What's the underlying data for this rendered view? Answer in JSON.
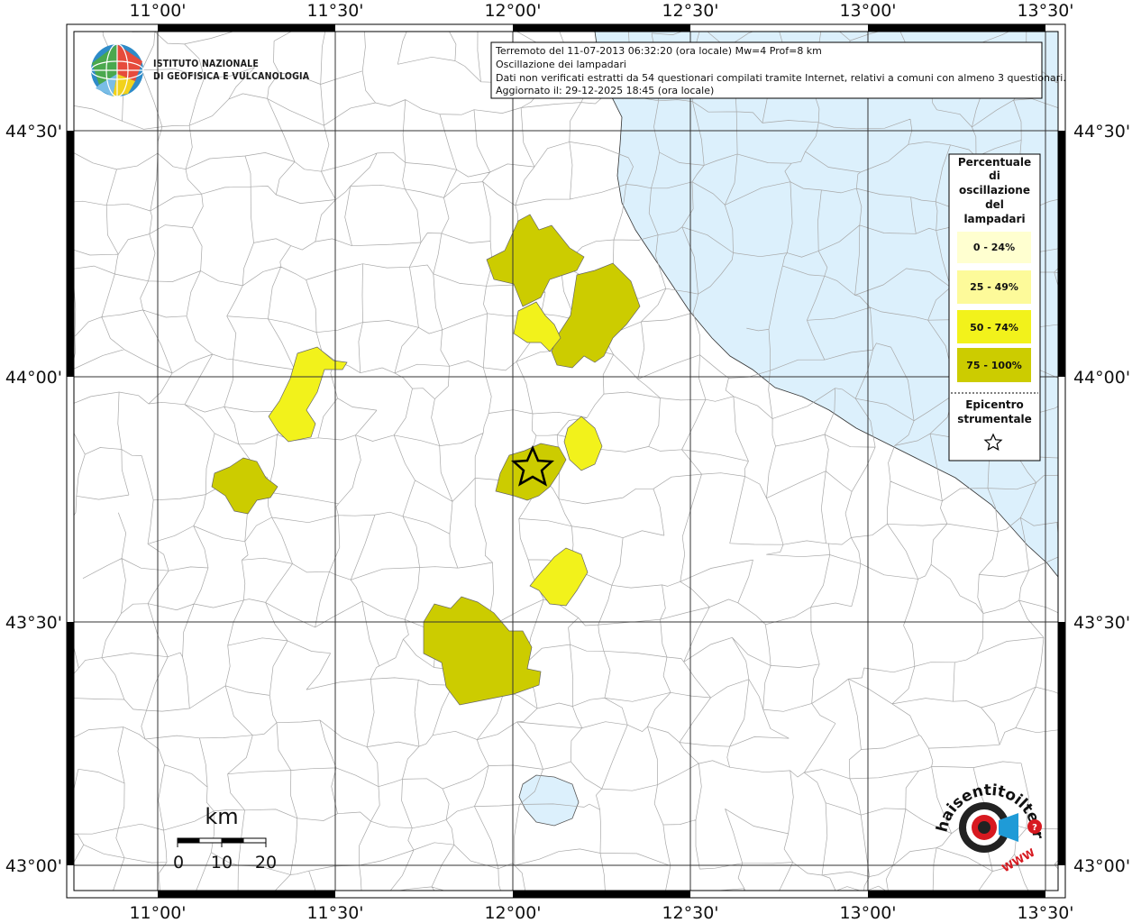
{
  "header": {
    "lines": [
      "Terremoto del 11-07-2013 06:32:20 (ora locale) Mw=4 Prof=8 km",
      "Oscillazione dei lampadari",
      "Dati non verificati estratti da 54 questionari compilati tramite Internet, relativi a comuni con almeno 3 questionari.",
      "Aggiornato il: 29-12-2025 18:45 (ora locale)"
    ]
  },
  "institute": {
    "line1": "ISTITUTO NAZIONALE",
    "line2": "DI GEOFISICA E VULCANOLOGIA"
  },
  "axes": {
    "lon_labels": [
      "11°00'",
      "11°30'",
      "12°00'",
      "12°30'",
      "13°00'",
      "13°30'"
    ],
    "lat_labels": [
      "44°30'",
      "44°00'",
      "43°30'",
      "43°00'"
    ]
  },
  "legend": {
    "title_lines": [
      "Percentuale",
      "di",
      "oscillazione",
      "del",
      "lampadari"
    ],
    "classes": [
      {
        "label": "0 - 24%",
        "color": "#ffffd0"
      },
      {
        "label": "25 - 49%",
        "color": "#fdfa9a"
      },
      {
        "label": "50 - 74%",
        "color": "#f2f21b"
      },
      {
        "label": "75 - 100%",
        "color": "#cccc00"
      }
    ],
    "epicenter_lines": [
      "Epicentro",
      "strumentale"
    ]
  },
  "scale_bar": {
    "unit": "km",
    "ticks": [
      "0",
      "10",
      "20"
    ]
  },
  "watermark": {
    "text": "haisentitoilterremoto.it",
    "url": "WWW"
  },
  "colors": {
    "sea": "#dcf0fc",
    "class_50_74": "#f2f21b",
    "class_75_100": "#cccc00"
  }
}
